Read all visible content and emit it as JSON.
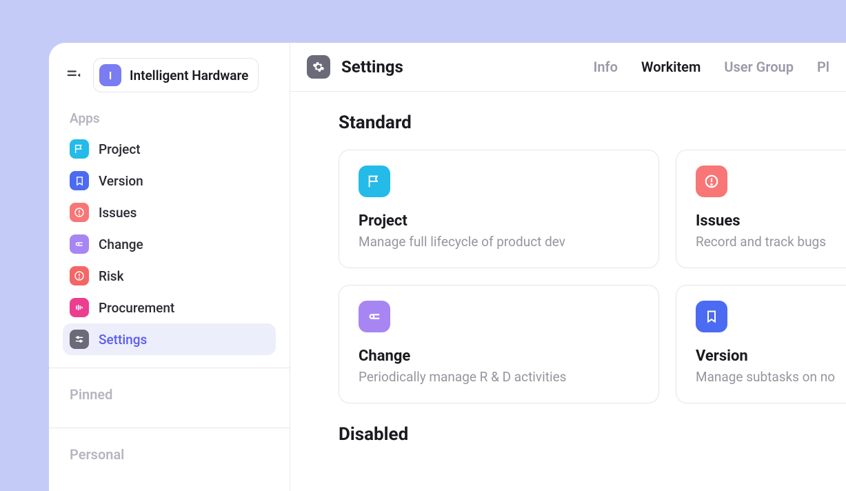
{
  "workspace": {
    "initial": "I",
    "name": "Intelligent Hardware"
  },
  "sidebar": {
    "apps_label": "Apps",
    "pinned_label": "Pinned",
    "personal_label": "Personal",
    "items": [
      {
        "label": "Project",
        "icon": "flag-icon",
        "color": "bg-cyan"
      },
      {
        "label": "Version",
        "icon": "bookmark-icon",
        "color": "bg-blue"
      },
      {
        "label": "Issues",
        "icon": "alert-icon",
        "color": "bg-coral"
      },
      {
        "label": "Change",
        "icon": "swap-icon",
        "color": "bg-purple"
      },
      {
        "label": "Risk",
        "icon": "alert-icon",
        "color": "bg-red"
      },
      {
        "label": "Procurement",
        "icon": "bars-icon",
        "color": "bg-pink"
      },
      {
        "label": "Settings",
        "icon": "sliders-icon",
        "color": "bg-gray"
      }
    ]
  },
  "header": {
    "title": "Settings",
    "tabs": [
      {
        "label": "Info",
        "active": false
      },
      {
        "label": "Workitem",
        "active": true
      },
      {
        "label": "User Group",
        "active": false
      },
      {
        "label": "Pl",
        "active": false
      }
    ]
  },
  "sections": {
    "standard": {
      "title": "Standard",
      "cards": [
        {
          "title": "Project",
          "desc": "Manage full lifecycle of product dev",
          "icon": "flag-icon",
          "color": "bg-cyan"
        },
        {
          "title": "Issues",
          "desc": "Record and track bugs",
          "icon": "alert-icon",
          "color": "bg-coral"
        },
        {
          "title": "Change",
          "desc": "Periodically manage R & D activities",
          "icon": "swap-icon",
          "color": "bg-purple"
        },
        {
          "title": "Version",
          "desc": "Manage subtasks on no",
          "icon": "bookmark-icon",
          "color": "bg-blue"
        }
      ]
    },
    "disabled": {
      "title": "Disabled"
    }
  }
}
